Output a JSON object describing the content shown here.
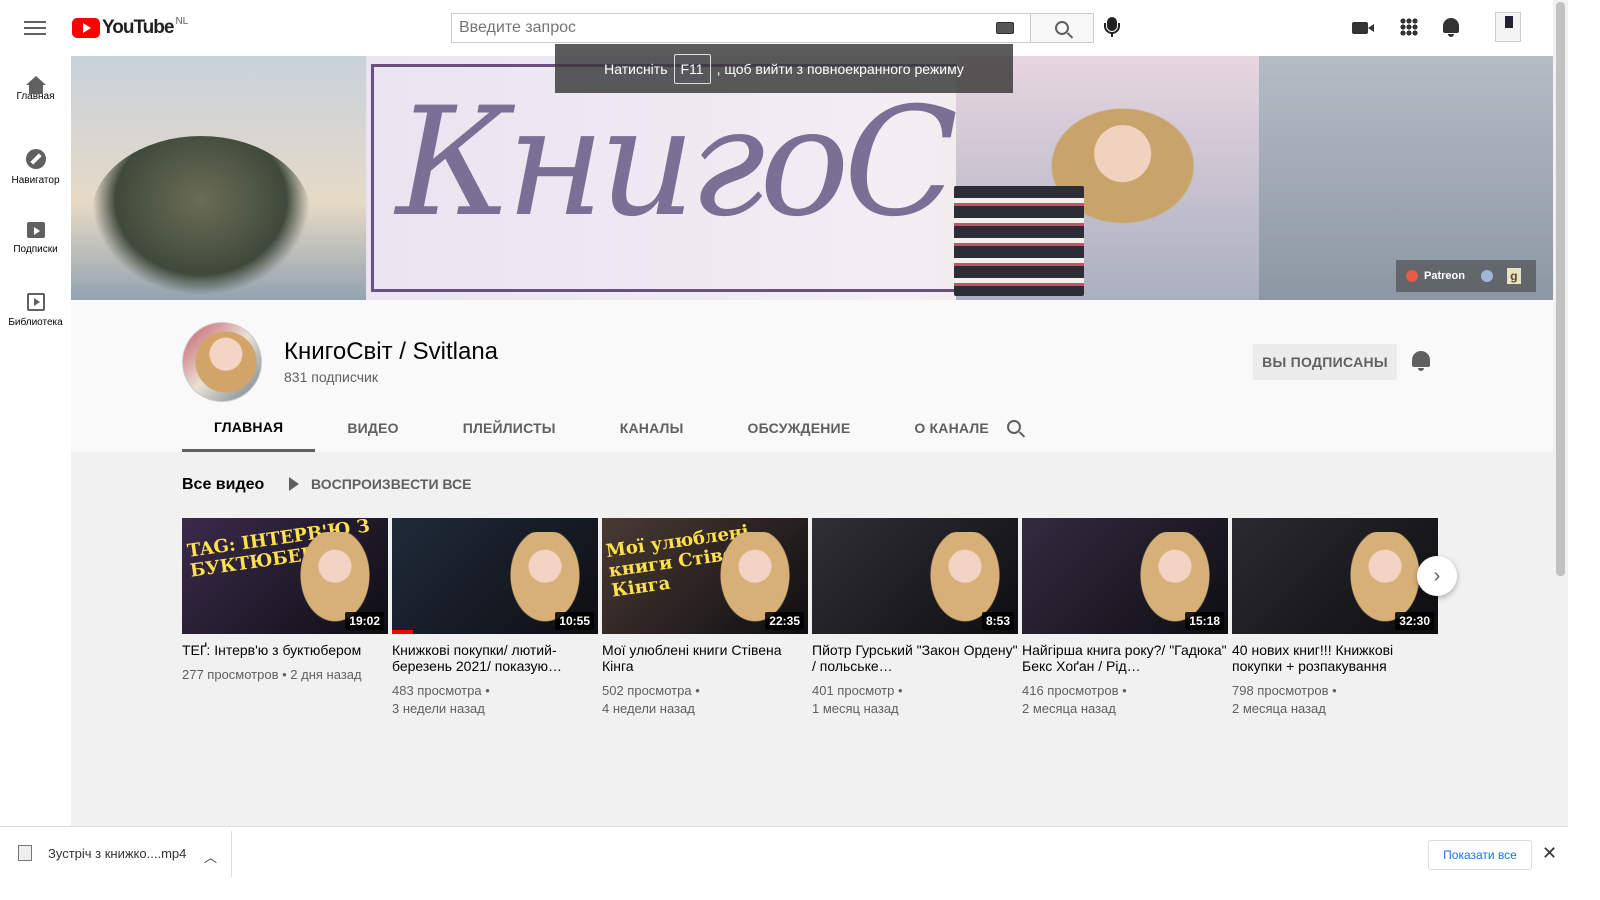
{
  "masthead": {
    "logo_text": "YouTube",
    "country": "NL",
    "search_placeholder": "Введите запрос"
  },
  "fullscreen_toast": {
    "before": "Натисніть",
    "key": "F11",
    "after": ", щоб вийти з повноекранного режиму"
  },
  "guide": [
    {
      "label": "Главная",
      "icon": "home-icon"
    },
    {
      "label": "Навигатор",
      "icon": "compass-icon"
    },
    {
      "label": "Подписки",
      "icon": "subscriptions-icon"
    },
    {
      "label": "Библиотека",
      "icon": "library-icon"
    }
  ],
  "banner": {
    "title": "КнигоСвіт",
    "links": {
      "patreon": "Patreon",
      "goodreads": "g"
    }
  },
  "channel": {
    "name": "КнигоСвіт / Svitlana",
    "subscribers": "831 подписчик",
    "subscribe_label": "ВЫ ПОДПИСАНЫ"
  },
  "tabs": [
    {
      "label": "ГЛАВНАЯ",
      "active": true
    },
    {
      "label": "ВИДЕО"
    },
    {
      "label": "ПЛЕЙЛИСТЫ"
    },
    {
      "label": "КАНАЛЫ"
    },
    {
      "label": "ОБСУЖДЕНИЕ"
    },
    {
      "label": "О КАНАЛЕ"
    }
  ],
  "shelf": {
    "title": "Все видео",
    "play_all": "ВОСПРОИЗВЕСТИ ВСЕ",
    "videos": [
      {
        "title": "ТЕҐ: Інтерв'ю з буктюбером",
        "views": "277 просмотров",
        "age": "2 дня назад",
        "duration": "19:02",
        "thumb_text": "TAG: ІНТЕРВ'Ю З БУКТЮБЕРОМ",
        "bg": "#3a2a4c",
        "progress": 0
      },
      {
        "title": "Книжкові покупки/ лютий-березень 2021/ показую…",
        "views": "483 просмотра",
        "age": "3 недели назад",
        "duration": "10:55",
        "thumb_text": "",
        "bg": "#1f2a3a",
        "progress": 0.1
      },
      {
        "title": "Мої улюблені книги Стівена Кінга",
        "views": "502 просмотра",
        "age": "4 недели назад",
        "duration": "22:35",
        "thumb_text": "Мої улюблені книги Стівена Кінга",
        "bg": "#4a3a33",
        "progress": 0
      },
      {
        "title": "Пйотр Гурський \"Закон Ордену\" / польське…",
        "views": "401 просмотр",
        "age": "1 месяц назад",
        "duration": "8:53",
        "thumb_text": "",
        "bg": "#2f2f36",
        "progress": 0
      },
      {
        "title": "Найгірша книга року?/ \"Гадюка\" Бекс Хоґан / Рід…",
        "views": "416 просмотров",
        "age": "2 месяца назад",
        "duration": "15:18",
        "thumb_text": "",
        "bg": "#332a40",
        "progress": 0
      },
      {
        "title": "40 нових книг!!! Книжкові покупки + розпакування",
        "views": "798 просмотров",
        "age": "2 месяца назад",
        "duration": "32:30",
        "thumb_text": "",
        "bg": "#2a2a30",
        "progress": 0
      }
    ]
  },
  "downloads": {
    "file": "Зустріч з книжко....mp4",
    "show_all": "Показати все"
  }
}
